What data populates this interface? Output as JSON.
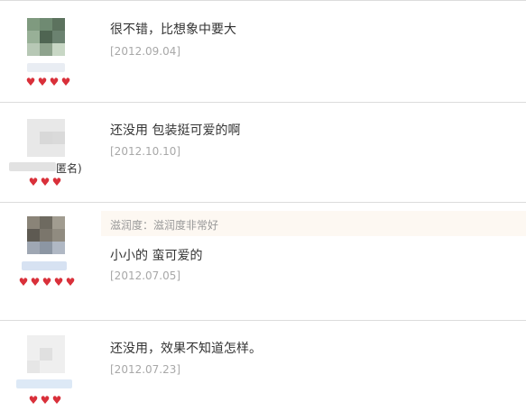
{
  "reviews": [
    {
      "rating": 4,
      "comment": "很不错，比想象中要大",
      "date": "[2012.09.04]",
      "username": ""
    },
    {
      "rating": 3,
      "comment": "还没用 包装挺可爱的啊",
      "date": "[2012.10.10]",
      "username": "匿名)"
    },
    {
      "rating": 5,
      "attribute": "滋润度：滋润度非常好",
      "comment": "小小的 蛮可爱的",
      "date": "[2012.07.05]",
      "username": ""
    },
    {
      "rating": 3,
      "comment": "还没用，效果不知道怎样。",
      "date": "[2012.07.23]",
      "username": ""
    }
  ],
  "icons": {
    "rating": "heart-icon",
    "avatar": "pixelated-avatar-icon"
  },
  "colors": {
    "heart": "#d9303a",
    "date": "#a8a8a8",
    "comment": "#333333",
    "attribute_bg": "#fdf8f2"
  }
}
